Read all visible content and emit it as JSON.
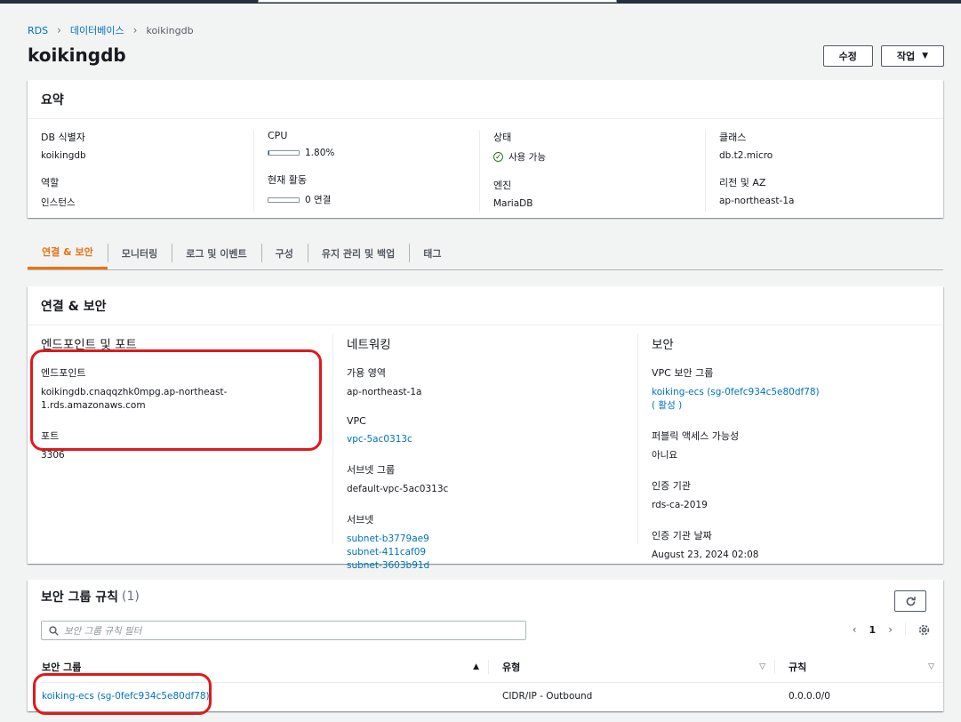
{
  "breadcrumb": {
    "root": "RDS",
    "databases": "데이터베이스",
    "current": "koikingdb"
  },
  "page_title": "koikingdb",
  "actions": {
    "modify": "수정",
    "actions": "작업"
  },
  "summary": {
    "title": "요약",
    "db_identifier_label": "DB 식별자",
    "db_identifier": "koikingdb",
    "role_label": "역할",
    "role": "인스턴스",
    "cpu_label": "CPU",
    "cpu": "1.80%",
    "cpu_fraction": 0.018,
    "activity_label": "현재 활동",
    "activity": "0 연결",
    "status_label": "상태",
    "status": "사용 가능",
    "engine_label": "엔진",
    "engine": "MariaDB",
    "class_label": "클래스",
    "class": "db.t2.micro",
    "region_label": "리전 및 AZ",
    "region": "ap-northeast-1a"
  },
  "tabs": [
    {
      "label": "연결 & 보안"
    },
    {
      "label": "모니터링"
    },
    {
      "label": "로그 및 이벤트"
    },
    {
      "label": "구성"
    },
    {
      "label": "유지 관리 및 백업"
    },
    {
      "label": "태그"
    }
  ],
  "connectivity": {
    "title": "연결 & 보안",
    "endpoint_section": {
      "title": "엔드포인트 및 포트",
      "endpoint_label": "엔드포인트",
      "endpoint": "koikingdb.cnaqqzhk0mpg.ap-northeast-1.rds.amazonaws.com",
      "port_label": "포트",
      "port": "3306"
    },
    "networking": {
      "title": "네트워킹",
      "az_label": "가용 영역",
      "az": "ap-northeast-1a",
      "vpc_label": "VPC",
      "vpc": "vpc-5ac0313c",
      "subnet_group_label": "서브넷 그룹",
      "subnet_group": "default-vpc-5ac0313c",
      "subnets_label": "서브넷",
      "subnets": [
        "subnet-b3779ae9",
        "subnet-411caf09",
        "subnet-3603b91d"
      ]
    },
    "security": {
      "title": "보안",
      "vpc_sg_label": "VPC 보안 그룹",
      "vpc_sg": "koiking-ecs (sg-0fefc934c5e80df78)",
      "vpc_sg_status": "( 활성 )",
      "public_label": "퍼블릭 액세스 가능성",
      "public": "아니요",
      "ca_label": "인증 기관",
      "ca": "rds-ca-2019",
      "ca_date_label": "인증 기관 날짜",
      "ca_date": "August 23, 2024 02:08"
    }
  },
  "rules": {
    "title": "보안 그룹 규칙",
    "count": "(1)",
    "filter_placeholder": "보안 그룹 규칙 필터",
    "page": "1",
    "columns": [
      "보안 그룹",
      "유형",
      "규칙"
    ],
    "rows": [
      {
        "group": "koiking-ecs (sg-0fefc934c5e80df78)",
        "type": "CIDR/IP - Outbound",
        "rule": "0.0.0.0/0"
      }
    ]
  },
  "colors": {
    "accent": "#ec7211",
    "link": "#0073bb",
    "success": "#1d8102",
    "annotation": "#e0191b"
  }
}
